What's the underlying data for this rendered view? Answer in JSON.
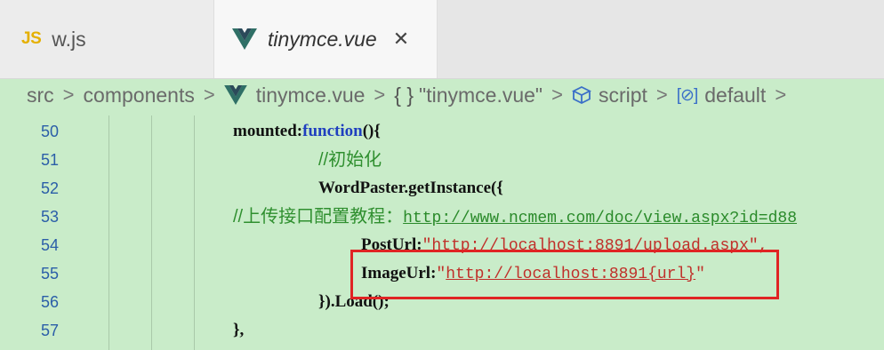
{
  "tabs": [
    {
      "icon": "javascript-file-icon",
      "badge": "JS",
      "label": "w.js"
    },
    {
      "icon": "vue-file-icon",
      "label": "tinymce.vue",
      "close": "✕"
    }
  ],
  "breadcrumb": {
    "items": [
      "src",
      "components",
      "tinymce.vue",
      "{ }",
      "\"tinymce.vue\"",
      "script",
      "default"
    ],
    "separator": ">",
    "ns_glyph": "[⊘]"
  },
  "editor": {
    "line_numbers": [
      "50",
      "51",
      "52",
      "53",
      "54",
      "55",
      "56",
      "57"
    ],
    "lines": {
      "l50_a": "mounted:",
      "l50_kw": "function",
      "l50_b": "(){",
      "l51": "//初始化",
      "l52": "WordPaster.getInstance({",
      "l53_comment": "//上传接口配置教程：",
      "l53_link": "http://www.ncmem.com/doc/view.aspx?id=d88",
      "l54_key": "PostUrl:",
      "l54_q1": "\"",
      "l54_url": "http://localhost:8891/upload.aspx",
      "l54_q2": "\",",
      "l55_key": "ImageUrl:",
      "l55_q1": "\"",
      "l55_url": "http://localhost:8891{url}",
      "l55_q2": "\"",
      "l56": "}).Load();",
      "l57": "},"
    }
  },
  "colors": {
    "editor_bg": "#c9ecc9",
    "line_number": "#2b5ea8",
    "keyword": "#1f3fbf",
    "comment": "#2f8f2f",
    "string": "#c0302a",
    "highlight_border": "#e02424",
    "vue_green": "#41b883",
    "vue_dark": "#2f5a6a"
  }
}
